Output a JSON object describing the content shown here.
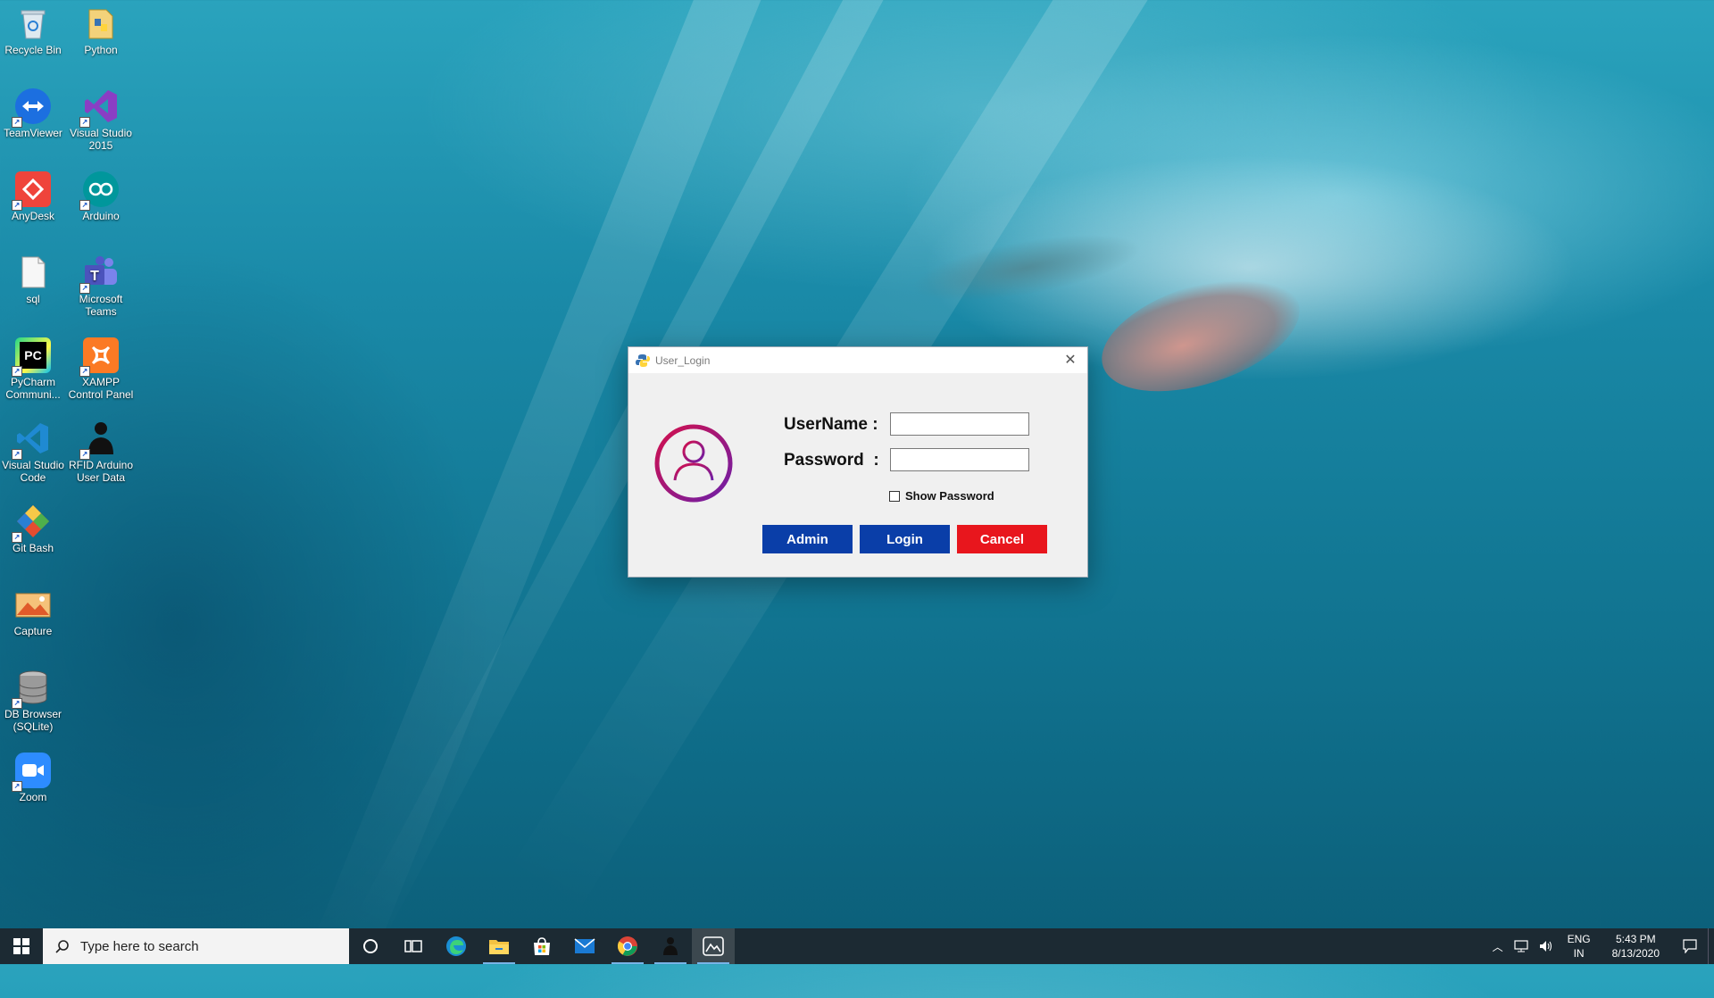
{
  "desktop": {
    "icons": [
      {
        "label": "Recycle Bin",
        "icon": "recycle-bin-icon"
      },
      {
        "label": "Python",
        "icon": "python-folder-icon"
      },
      {
        "label": "TeamViewer",
        "icon": "teamviewer-icon"
      },
      {
        "label": "Visual Studio 2015",
        "icon": "visual-studio-icon"
      },
      {
        "label": "AnyDesk",
        "icon": "anydesk-icon"
      },
      {
        "label": "Arduino",
        "icon": "arduino-icon"
      },
      {
        "label": "sql",
        "icon": "text-file-icon"
      },
      {
        "label": "Microsoft Teams",
        "icon": "teams-icon"
      },
      {
        "label": "PyCharm Communi...",
        "icon": "pycharm-icon"
      },
      {
        "label": "XAMPP Control Panel",
        "icon": "xampp-icon"
      },
      {
        "label": "Visual Studio Code",
        "icon": "vscode-icon"
      },
      {
        "label": "RFID Arduino User Data",
        "icon": "user-silhouette-icon"
      },
      {
        "label": "Git Bash",
        "icon": "git-bash-icon"
      },
      {
        "label": "Capture",
        "icon": "image-icon"
      },
      {
        "label": "DB Browser (SQLite)",
        "icon": "database-icon"
      },
      {
        "label": "Zoom",
        "icon": "zoom-icon"
      }
    ]
  },
  "dialog": {
    "title": "User_Login",
    "username_label": "UserName :",
    "password_label": "Password  :",
    "username_value": "",
    "password_value": "",
    "show_password_label": "Show Password",
    "show_password_checked": false,
    "admin_label": "Admin",
    "login_label": "Login",
    "cancel_label": "Cancel",
    "colors": {
      "admin": "#0a3ea8",
      "login": "#0a3ea8",
      "cancel": "#e8161d",
      "avatar_ring_start": "#d0104e",
      "avatar_ring_end": "#7a1fa2"
    }
  },
  "taskbar": {
    "search_placeholder": "Type here to search",
    "apps": [
      "cortana-icon",
      "task-view-icon",
      "edge-icon",
      "file-explorer-icon",
      "store-icon",
      "mail-icon",
      "chrome-icon",
      "user-app-icon",
      "python-app-icon"
    ],
    "tray": {
      "lang_line1": "ENG",
      "lang_line2": "IN",
      "time": "5:43 PM",
      "date": "8/13/2020"
    }
  }
}
